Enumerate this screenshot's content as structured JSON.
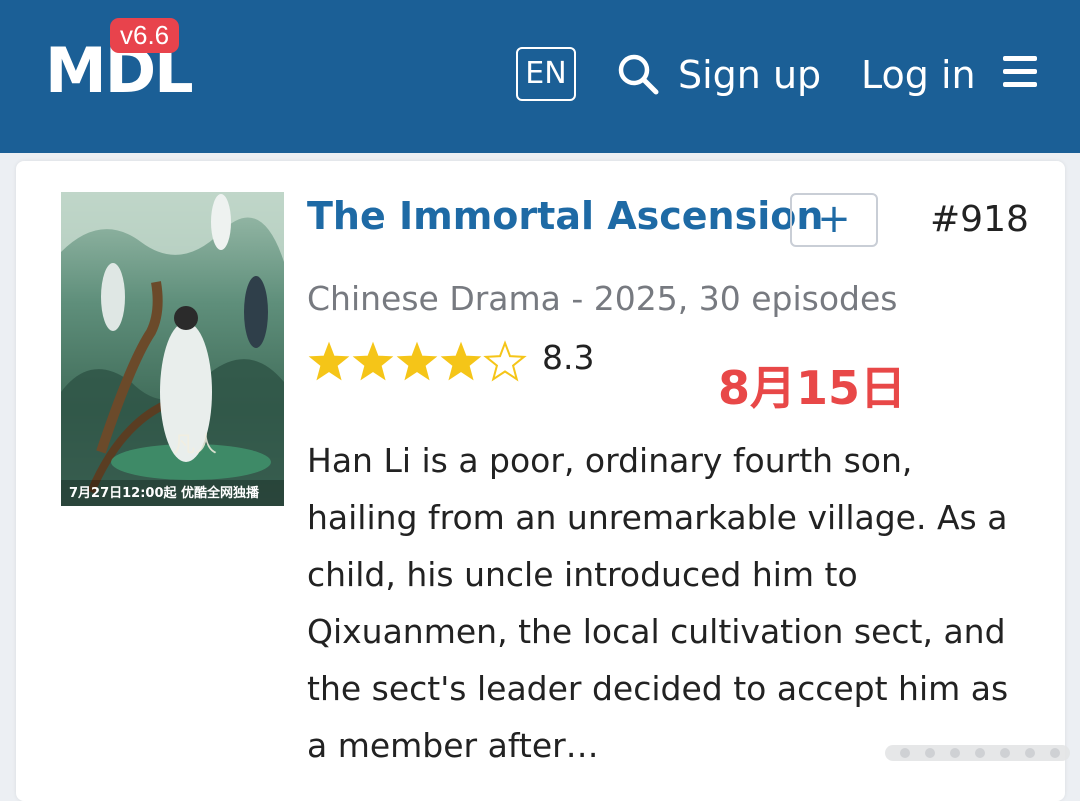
{
  "header": {
    "logo": "MDL",
    "version": "v6.6",
    "language": "EN",
    "signup_label": "Sign up",
    "login_label": "Log in",
    "icons": [
      "search-icon",
      "hamburger-menu-icon"
    ],
    "bg_color": "#1b5f96",
    "badge_color": "#e8434c"
  },
  "drama": {
    "title": "The Immortal Ascension",
    "add_label": "+",
    "rank": "#918",
    "meta": "Chinese Drama - 2025, 30 episodes",
    "rating": "8.3",
    "stars_filled": 4,
    "stars_total": 5,
    "star_color": "#f5c518",
    "date_tag": "8月15日",
    "date_tag_color": "#e84848",
    "synopsis": "Han Li is a poor, ordinary fourth son, hailing from an unremarkable village. As a child, his uncle introduced him to Qixuanmen, the local cultivation sect, and the sect's leader decided to accept him as a member after…",
    "poster_caption": "7月27日12:00起 优酷全网独播"
  }
}
